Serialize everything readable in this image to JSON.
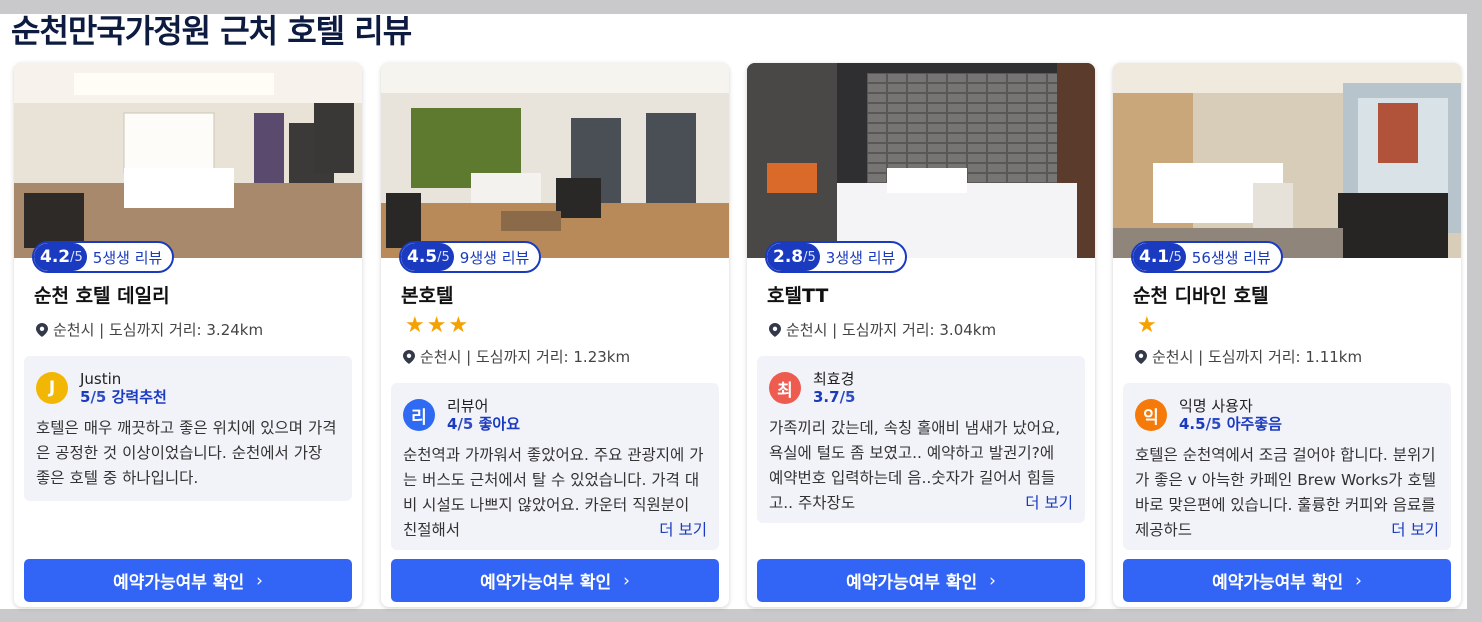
{
  "page": {
    "title": "순천만국가정원 근처 호텔 리뷰"
  },
  "cards": [
    {
      "rating": "4.2",
      "rating_outof": "/5",
      "review_count": "5생생 리뷰",
      "name": "순천 호텔 데일리",
      "stars": "",
      "location": "순천시 | 도심까지 거리: 3.24km",
      "reviewer": {
        "initial": "J",
        "name": "Justin",
        "score": "5",
        "score_outof": "/5",
        "verdict": "강력추천",
        "avatar_color": "#f2b705"
      },
      "review_text": "호텔은 매우 깨끗하고 좋은 위치에 있으며 가격은 공정한 것 이상이었습니다. 순천에서 가장 좋은 호텔 중 하나입니다.",
      "more": "",
      "cta": "예약가능여부 확인"
    },
    {
      "rating": "4.5",
      "rating_outof": "/5",
      "review_count": "9생생 리뷰",
      "name": "본호텔",
      "stars": "★★★",
      "location": "순천시 | 도심까지 거리: 1.23km",
      "reviewer": {
        "initial": "리",
        "name": "리뷰어",
        "score": "4",
        "score_outof": "/5",
        "verdict": "좋아요",
        "avatar_color": "#2f6bf2"
      },
      "review_text": "순천역과 가까워서 좋았어요. 주요 관광지에 가는 버스도 근처에서 탈 수 있었습니다. 가격 대비 시설도 나쁘지 않았어요. 카운터 직원분이 친절해서",
      "more": "더 보기",
      "cta": "예약가능여부 확인"
    },
    {
      "rating": "2.8",
      "rating_outof": "/5",
      "review_count": "3생생 리뷰",
      "name": "호텔TT",
      "stars": "",
      "location": "순천시 | 도심까지 거리: 3.04km",
      "reviewer": {
        "initial": "최",
        "name": "최효경",
        "score": "3.7",
        "score_outof": "/5",
        "verdict": "",
        "avatar_color": "#ee5b4f"
      },
      "review_text": "가족끼리 갔는데, 속칭 홀애비 냄새가 났어요, 욕실에 털도 좀 보였고.. 예약하고 발권기?에 예약번호 입력하는데 음..숫자가 길어서 힘들고.. 주차장도",
      "more": "더 보기",
      "cta": "예약가능여부 확인"
    },
    {
      "rating": "4.1",
      "rating_outof": "/5",
      "review_count": "56생생 리뷰",
      "name": "순천 디바인 호텔",
      "stars": "★",
      "location": "순천시 | 도심까지 거리: 1.11km",
      "reviewer": {
        "initial": "익",
        "name": "익명 사용자",
        "score": "4.5",
        "score_outof": "/5",
        "verdict": "아주좋음",
        "avatar_color": "#f57a0a"
      },
      "review_text": "호텔은 순천역에서 조금 걸어야 합니다. 분위기가 좋은 v 아늑한 카페인 Brew Works가 호텔 바로 맞은편에 있습니다. 훌륭한 커피와 음료를 제공하드",
      "more": "더 보기",
      "cta": "예약가능여부 확인"
    }
  ],
  "colors": {
    "accent": "#1a3bbf",
    "button": "#3264f5",
    "star": "#f5a100"
  }
}
